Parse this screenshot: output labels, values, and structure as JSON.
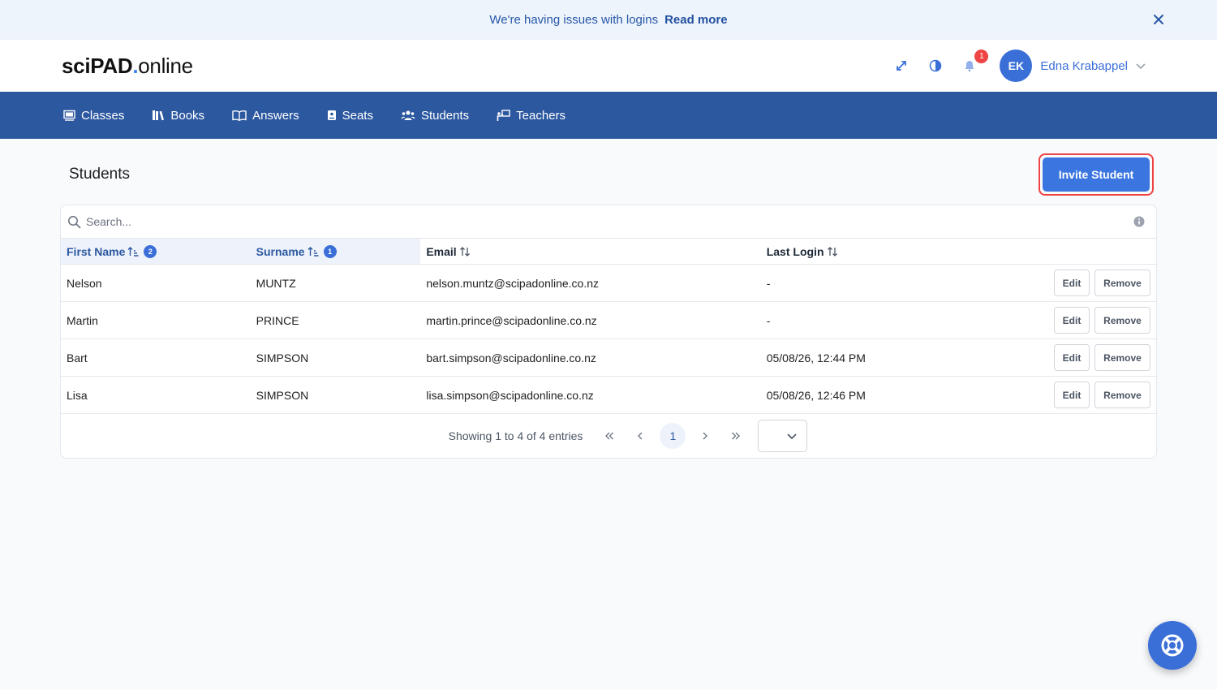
{
  "banner": {
    "message": "We're having issues with logins",
    "link": "Read more"
  },
  "header": {
    "logo": {
      "bold": "sciPAD",
      "dot": ".",
      "rest": "online"
    },
    "notification_count": "1",
    "user": {
      "initials": "EK",
      "name": "Edna Krabappel"
    }
  },
  "nav": {
    "items": [
      {
        "label": "Classes"
      },
      {
        "label": "Books"
      },
      {
        "label": "Answers"
      },
      {
        "label": "Seats"
      },
      {
        "label": "Students"
      },
      {
        "label": "Teachers"
      }
    ]
  },
  "page": {
    "title": "Students",
    "invite_label": "Invite Student"
  },
  "table": {
    "search_placeholder": "Search...",
    "columns": [
      {
        "label": "First Name",
        "sort_order": "2"
      },
      {
        "label": "Surname",
        "sort_order": "1"
      },
      {
        "label": "Email"
      },
      {
        "label": "Last Login"
      }
    ],
    "rows": [
      {
        "first": "Nelson",
        "surname": "MUNTZ",
        "email": "nelson.muntz@scipadonline.co.nz",
        "last_login": "-"
      },
      {
        "first": "Martin",
        "surname": "PRINCE",
        "email": "martin.prince@scipadonline.co.nz",
        "last_login": "-"
      },
      {
        "first": "Bart",
        "surname": "SIMPSON",
        "email": "bart.simpson@scipadonline.co.nz",
        "last_login": "05/08/26, 12:44 PM"
      },
      {
        "first": "Lisa",
        "surname": "SIMPSON",
        "email": "lisa.simpson@scipadonline.co.nz",
        "last_login": "05/08/26, 12:46 PM"
      }
    ],
    "edit_label": "Edit",
    "remove_label": "Remove"
  },
  "pagination": {
    "info": "Showing 1 to 4 of 4 entries",
    "current_page": "1"
  },
  "colors": {
    "nav_bg": "#2c58a0",
    "accent": "#3b6fd8",
    "highlight": "#ef4444"
  }
}
